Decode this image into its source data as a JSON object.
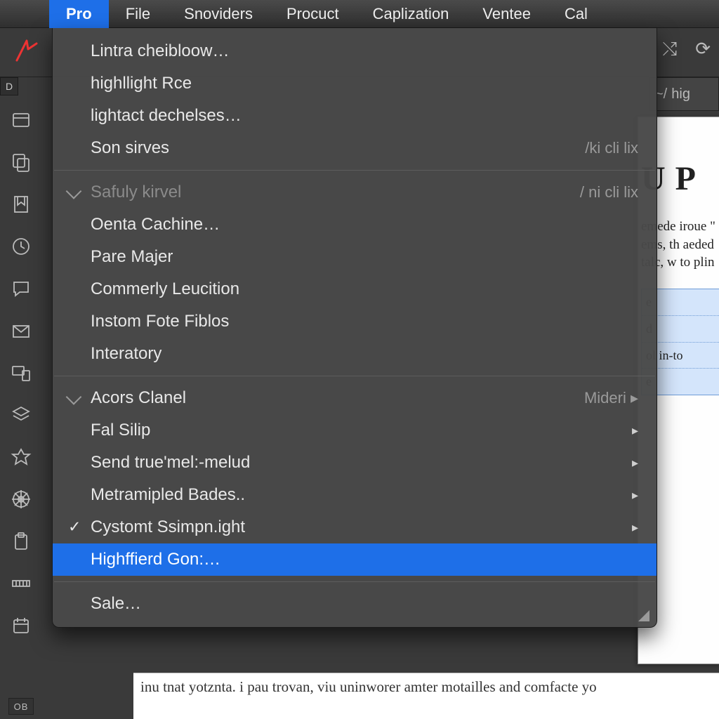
{
  "menubar": {
    "apple": "",
    "items": [
      "Pro",
      "File",
      "Snoviders",
      "Procuct",
      "Caplization",
      "Ventee",
      "Cal"
    ],
    "active_index": 0
  },
  "toolbar": {
    "right_icons": [
      "swap-icon",
      "refresh-icon"
    ],
    "tiny_label": "D"
  },
  "breadcrumb": {
    "sep": "~/",
    "text": "hig"
  },
  "toolstrip": {
    "ob_label": "OB"
  },
  "paper": {
    "heading": "U P",
    "para": "emede iroue \" ems, th aeded talc, w to plin",
    "bluecells": [
      "e",
      "d",
      "ol in-to",
      "e"
    ]
  },
  "caption": "inu    tnat yotznta. i pau trovan, viu uninworer amter motailles and comfacte yo",
  "dropdown": {
    "groups": [
      {
        "items": [
          {
            "label": "Lintra cheibloow…",
            "shortcut": "",
            "type": "plain"
          },
          {
            "label": "highllight Rce",
            "shortcut": "",
            "type": "plain"
          },
          {
            "label": "lightact dechelses…",
            "shortcut": "",
            "type": "plain"
          },
          {
            "label": "Son sirves",
            "shortcut": "/ki cli lix",
            "type": "plain"
          }
        ]
      },
      {
        "items": [
          {
            "label": "Safuly kirvel",
            "shortcut": "/ ni cli lix",
            "type": "chev",
            "disabled": true
          },
          {
            "label": "Oenta Cachine…",
            "shortcut": "",
            "type": "plain"
          },
          {
            "label": "Pare Majer",
            "shortcut": "",
            "type": "plain"
          },
          {
            "label": "Commerly Leucition",
            "shortcut": "",
            "type": "plain"
          },
          {
            "label": "Instom Fote Fiblos",
            "shortcut": "",
            "type": "plain"
          },
          {
            "label": "Interatory",
            "shortcut": "",
            "type": "plain"
          }
        ]
      },
      {
        "items": [
          {
            "label": "Acors Clanel",
            "shortcut": "Mideri",
            "type": "chev",
            "submenu": true,
            "twotone": true
          },
          {
            "label": "Fal Silip",
            "shortcut": "",
            "type": "plain",
            "submenu": true
          },
          {
            "label": "Send true'mel:-melud",
            "shortcut": "",
            "type": "plain",
            "submenu": true
          },
          {
            "label": "Metramipled Bades..",
            "shortcut": "",
            "type": "plain",
            "submenu": true
          },
          {
            "label": "Cystomt Ssimpn.ight",
            "shortcut": "",
            "type": "check",
            "submenu": true
          },
          {
            "label": "Highffierd Gon:…",
            "shortcut": "",
            "type": "plain",
            "highlight": true
          }
        ]
      },
      {
        "items": [
          {
            "label": "Sale…",
            "shortcut": "",
            "type": "plain"
          }
        ]
      }
    ]
  }
}
